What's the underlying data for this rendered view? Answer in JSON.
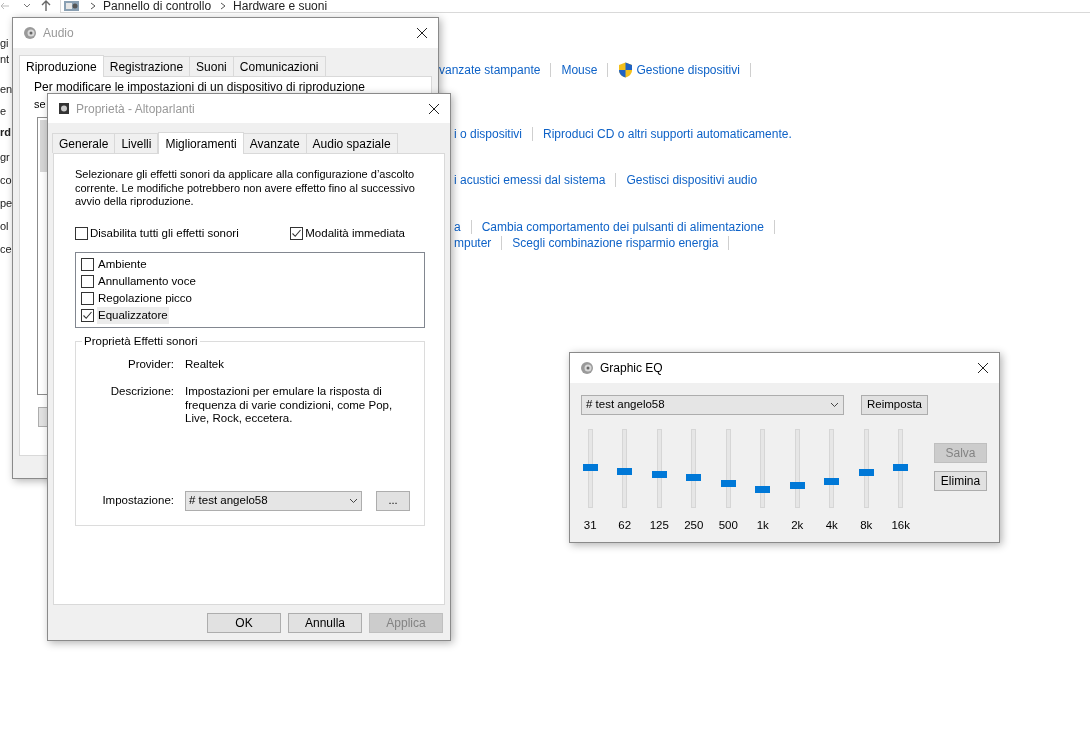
{
  "explorer": {
    "breadcrumb": [
      "Pannello di controllo",
      "Hardware e suoni"
    ],
    "left_fragments": [
      {
        "text": "gi",
        "bold": false
      },
      {
        "text": "nt",
        "bold": false
      },
      {
        "text": "en",
        "bold": false
      },
      {
        "text": "e",
        "bold": false
      },
      {
        "text": "rd",
        "bold": true
      },
      {
        "text": "gr",
        "bold": false
      },
      {
        "text": "co",
        "bold": false
      },
      {
        "text": "pe",
        "bold": false
      },
      {
        "text": "ol",
        "bold": false
      },
      {
        "text": "ce",
        "bold": false
      }
    ],
    "link_rows": [
      {
        "links": [
          {
            "text": "vanzate stampante",
            "kind": "link"
          },
          {
            "text": "Mouse",
            "kind": "link"
          },
          {
            "text": "Gestione dispositivi",
            "kind": "shield"
          }
        ],
        "trailing_divider": true
      },
      {
        "links": [
          {
            "text": "i o dispositivi",
            "kind": "link"
          },
          {
            "text": "Riproduci CD o altri supporti automaticamente.",
            "kind": "link"
          }
        ],
        "trailing_divider": false
      },
      {
        "links": [
          {
            "text": "i acustici emessi dal sistema",
            "kind": "link"
          },
          {
            "text": "Gestisci dispositivi audio",
            "kind": "link"
          }
        ],
        "trailing_divider": false
      },
      {
        "links": [
          {
            "text": "a",
            "kind": "link"
          },
          {
            "text": "Cambia comportamento dei pulsanti di alimentazione",
            "kind": "link"
          }
        ],
        "trailing_divider": true
      },
      {
        "links": [
          {
            "text": "mputer",
            "kind": "link"
          },
          {
            "text": "Scegli combinazione risparmio energia",
            "kind": "link"
          }
        ],
        "trailing_divider": true
      }
    ]
  },
  "audio_window": {
    "title": "Audio",
    "tabs": [
      {
        "label": "Riproduzione",
        "selected": true
      },
      {
        "label": "Registrazione",
        "selected": false
      },
      {
        "label": "Suoni",
        "selected": false
      },
      {
        "label": "Comunicazioni",
        "selected": false
      }
    ],
    "intro": [
      "Per modificare le impostazioni di un dispositivo di riproduzione",
      "se"
    ]
  },
  "properties_window": {
    "title": "Proprietà - Altoparlanti",
    "tabs": [
      {
        "label": "Generale",
        "selected": false
      },
      {
        "label": "Livelli",
        "selected": false
      },
      {
        "label": "Miglioramenti",
        "selected": true
      },
      {
        "label": "Avanzate",
        "selected": false
      },
      {
        "label": "Audio spaziale",
        "selected": false
      }
    ],
    "description": "Selezionare gli effetti sonori da applicare alla configurazione d’ascolto corrente. Le modifiche potrebbero non avere effetto fino al successivo avvio della riproduzione.",
    "options": [
      {
        "label": "Disabilita tutti gli effetti sonori",
        "checked": false
      },
      {
        "label": "Modalità immediata",
        "checked": true
      }
    ],
    "effects": [
      {
        "label": "Ambiente",
        "checked": false,
        "selected": false
      },
      {
        "label": "Annullamento voce",
        "checked": false,
        "selected": false
      },
      {
        "label": "Regolazione picco",
        "checked": false,
        "selected": false
      },
      {
        "label": "Equalizzatore",
        "checked": true,
        "selected": true
      }
    ],
    "group_title": "Proprietà Effetti sonori",
    "provider_label": "Provider:",
    "provider": "Realtek",
    "description_label": "Descrizione:",
    "description_text": "Impostazioni per emulare la risposta di frequenza di varie condizioni, come Pop, Live, Rock, eccetera.",
    "setting_label": "Impostazione:",
    "setting_value": "# test angelo58",
    "more_button": "...",
    "buttons": [
      {
        "label": "OK",
        "disabled": false
      },
      {
        "label": "Annulla",
        "disabled": false
      },
      {
        "label": "Applica",
        "disabled": true
      }
    ]
  },
  "eq_window": {
    "title": "Graphic EQ",
    "preset": "# test angelo58",
    "reset_button": "Reimposta",
    "bands": [
      {
        "label": "31",
        "level": 0.51
      },
      {
        "label": "62",
        "level": 0.46
      },
      {
        "label": "125",
        "level": 0.43
      },
      {
        "label": "250",
        "level": 0.38
      },
      {
        "label": "500",
        "level": 0.31
      },
      {
        "label": "1k",
        "level": 0.24
      },
      {
        "label": "2k",
        "level": 0.29
      },
      {
        "label": "4k",
        "level": 0.34
      },
      {
        "label": "8k",
        "level": 0.45
      },
      {
        "label": "16k",
        "level": 0.51
      }
    ],
    "buttons": [
      {
        "label": "Salva",
        "disabled": true
      },
      {
        "label": "Elimina",
        "disabled": false
      }
    ]
  }
}
